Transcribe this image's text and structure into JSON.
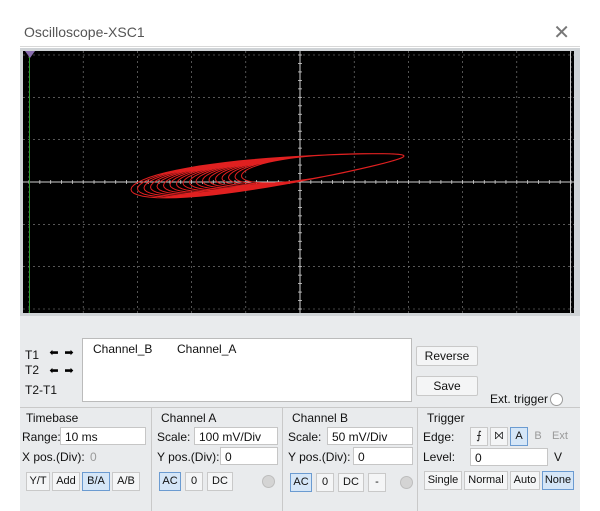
{
  "window": {
    "title": "Oscilloscope-XSC1"
  },
  "readout": {
    "labels": {
      "t1": "T1",
      "t2": "T2",
      "t2t1": "T2-T1"
    },
    "columns": [
      "Channel_B",
      "Channel_A"
    ]
  },
  "buttons": {
    "reverse": "Reverse",
    "save": "Save"
  },
  "ext_trigger": {
    "label": "Ext. trigger"
  },
  "timebase": {
    "title": "Timebase",
    "range_label": "Range:",
    "range_value": "10 ms",
    "xpos_label": "X pos.(Div):",
    "xpos_value": "0",
    "modes": [
      "Y/T",
      "Add",
      "B/A",
      "A/B"
    ],
    "active_mode": "B/A"
  },
  "channel_a": {
    "title": "Channel A",
    "scale_label": "Scale:",
    "scale_value": "100 mV/Div",
    "ypos_label": "Y pos.(Div):",
    "ypos_value": "0",
    "coupling": [
      "AC",
      "0",
      "DC"
    ],
    "active_coupling": "AC"
  },
  "channel_b": {
    "title": "Channel B",
    "scale_label": "Scale:",
    "scale_value": "50 mV/Div",
    "ypos_label": "Y pos.(Div):",
    "ypos_value": "0",
    "coupling": [
      "AC",
      "0",
      "DC",
      "-"
    ],
    "active_coupling": "AC"
  },
  "trigger": {
    "title": "Trigger",
    "edge_label": "Edge:",
    "edge_buttons": [
      "A",
      "B",
      "Ext"
    ],
    "level_label": "Level:",
    "level_value": "0",
    "level_unit": "V",
    "modes": [
      "Single",
      "Normal",
      "Auto",
      "None"
    ],
    "active_mode": "None"
  },
  "colors": {
    "trace": "#e02020",
    "grid": "#8a8a8a",
    "screen_bg": "#000000",
    "cursor_t1": "#2e9e2e"
  }
}
